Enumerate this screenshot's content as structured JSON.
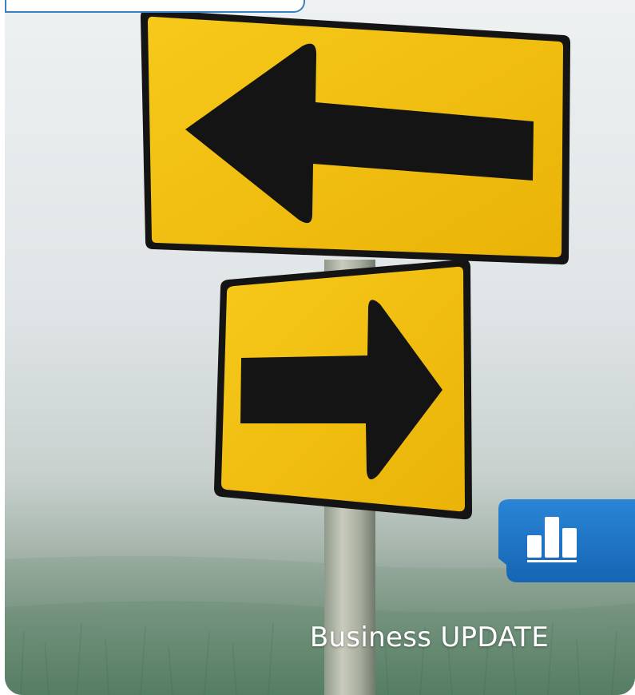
{
  "title": "Business UPDATE",
  "icons": {
    "badge": "bar-chart-icon",
    "sign_top": "left-arrow-icon",
    "sign_bottom": "right-arrow-icon"
  },
  "colors": {
    "sign_yellow": "#f2c10f",
    "arrow_black": "#141414",
    "badge_blue": "#1f74c4",
    "fog_top": "#e8ecee",
    "grass_bottom": "#4f7a5e",
    "title_text": "#ffffff"
  }
}
